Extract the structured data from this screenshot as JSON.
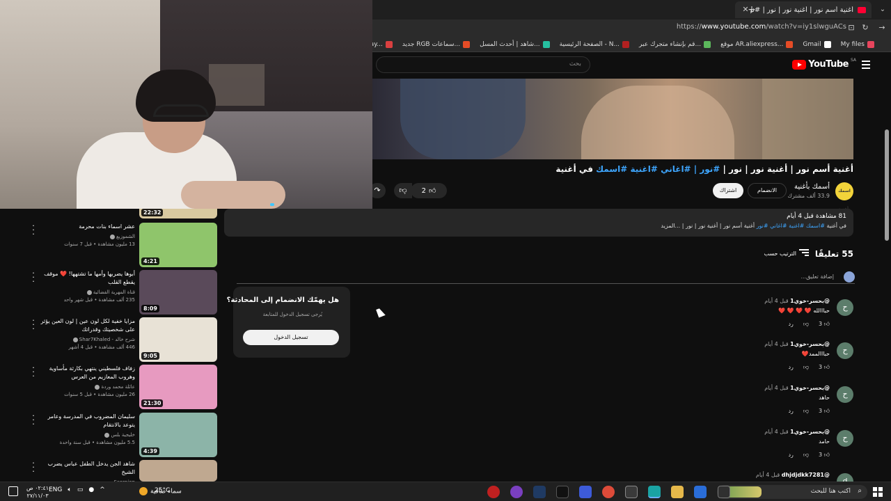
{
  "browser": {
    "tab_title": "أغنية أسم نور | أغنية نور | نور | #نور",
    "url_prefix": "https://",
    "url_domain": "www.youtube.com",
    "url_path": "/watch?v=iy1slwguACs",
    "bookmarks": [
      {
        "label": "My files",
        "color": "#e8455d"
      },
      {
        "label": "Gmail",
        "color": "#ffffff"
      },
      {
        "label": "موقع AR.aliexpress...",
        "color": "#e54c26"
      },
      {
        "label": "قم بإنشاء متجرك عبر...",
        "color": "#5cb85c"
      },
      {
        "label": "الصفحة الرئيسية - N...",
        "color": "#b22020"
      },
      {
        "label": "شاهد | أحدث المسل...",
        "color": "#26c0a0"
      },
      {
        "label": "جديد RGB سماعات...",
        "color": "#e54c26"
      },
      {
        "label": "Codenames – Play...",
        "color": "#d94040"
      }
    ]
  },
  "youtube": {
    "logo_text": "YouTube",
    "region": "SA",
    "search_placeholder": "بحث"
  },
  "video": {
    "title_plain1": "أغنية أسم نور | أغنية نور | نور | ",
    "title_tags": "#نور | #اغاني #اغنية #اسمك",
    "title_plain2": " في أغنية",
    "channel_name": "أسمك بأغنية",
    "channel_subs": "33.9 ألف مشترك",
    "channel_avatar_text": "اسمك بأغنية",
    "join_label": "الانضمام",
    "subscribe_label": "اشتراك",
    "likes": "2",
    "views_line": "81 مشاهدة",
    "time_line": "قبل 4 أيام",
    "desc_prefix": "في أغنية",
    "desc_tags": "#اسمك #اغنية #اغاني #نور",
    "desc_rest": "أغنية أسم نور | أغنية نور | نور | ...المزيد"
  },
  "comments": {
    "count_label": "55 تعليقًا",
    "sort_label": "الترتيب حسب",
    "add_placeholder": "إضافة تعليق...",
    "reply_label": "رد",
    "items": [
      {
        "author": "@بحسر-خوي1",
        "time": "قبل 4 أيام",
        "text": "حبااالله ",
        "hearts": "❤️ ❤️ ❤️ ❤️",
        "likes": "3",
        "initial": "ح"
      },
      {
        "author": "@بحسر-خوي1",
        "time": "قبل 4 أيام",
        "text": "حبااالممد",
        "hearts": "❤️",
        "likes": "3",
        "initial": "ح"
      },
      {
        "author": "@بحسر-خوي1",
        "time": "قبل 4 أيام",
        "text": "حاهد",
        "hearts": "",
        "likes": "3",
        "initial": "ح"
      },
      {
        "author": "@بحسر-خوي1",
        "time": "قبل 4 أيام",
        "text": "حامد",
        "hearts": "",
        "likes": "3",
        "initial": "ح"
      },
      {
        "author": "@dhjdjdkk7281",
        "time": "قبل 4 أيام",
        "text": "",
        "hearts": "",
        "likes": "",
        "initial": "d"
      }
    ]
  },
  "recommendations": [
    {
      "title": "عشر اسماء بنات محرمة",
      "channel": "الشموزيع",
      "meta": "13 مليون مشاهدة • قبل 7 سنوات",
      "duration": "4:21",
      "thumb": "#8fc56b"
    },
    {
      "title": "أبوها يضربها وأمها ما تشتهها! ❤️ موقف يقطع القلب",
      "channel": "قناة المهرية الفضائية",
      "meta": "235 ألف مشاهدة • قبل شهر واحد",
      "duration": "8:09",
      "thumb": "#5a4a5a"
    },
    {
      "title": "مزايا خفية لكل لون عين | لون العين يؤثر على شخصيتك وقدراتك",
      "channel": "شرح خالد - Shar7Khaled",
      "meta": "446 ألف مشاهدة • قبل 4 أشهر",
      "duration": "9:05",
      "thumb": "#e8e2d6"
    },
    {
      "title": "زفاف فلسطيني ينتهي بكارثة مأساوية وهروب المعازيم من العرس",
      "channel": "عائلة محمد وردة",
      "meta": "26 مليون مشاهدة • قبل 5 سنوات",
      "duration": "21:30",
      "thumb": "#e79ac0"
    },
    {
      "title": "سليمان المضروب في المدرسة وعامر يتوعد بالانتقام",
      "channel": "خليجية بلس",
      "meta": "5.5 مليون مشاهدة • قبل سنة واحدة",
      "duration": "4:39",
      "thumb": "#8cb4a8"
    },
    {
      "title": "شاهد الجن يدخل الطفل عباس يضرب الشيخ",
      "channel": "Scorpion",
      "meta": "",
      "duration": "",
      "thumb": "#bfa890"
    }
  ],
  "prev_rec_duration": "22:32",
  "dialog": {
    "title": "هل يهمّك الانضمام إلى المحادثة؟",
    "subtitle": "يُرجى تسجيل الدخول للمتابعة",
    "button": "تسجيل الدخول"
  },
  "taskbar": {
    "search_text": "اكتب هنا للبحث",
    "weather": "سماء صافية",
    "temp": "25°C",
    "lang": "ENG",
    "time": "٠٢:٤١ ص",
    "date": "٢٧/١١/٠٣"
  }
}
